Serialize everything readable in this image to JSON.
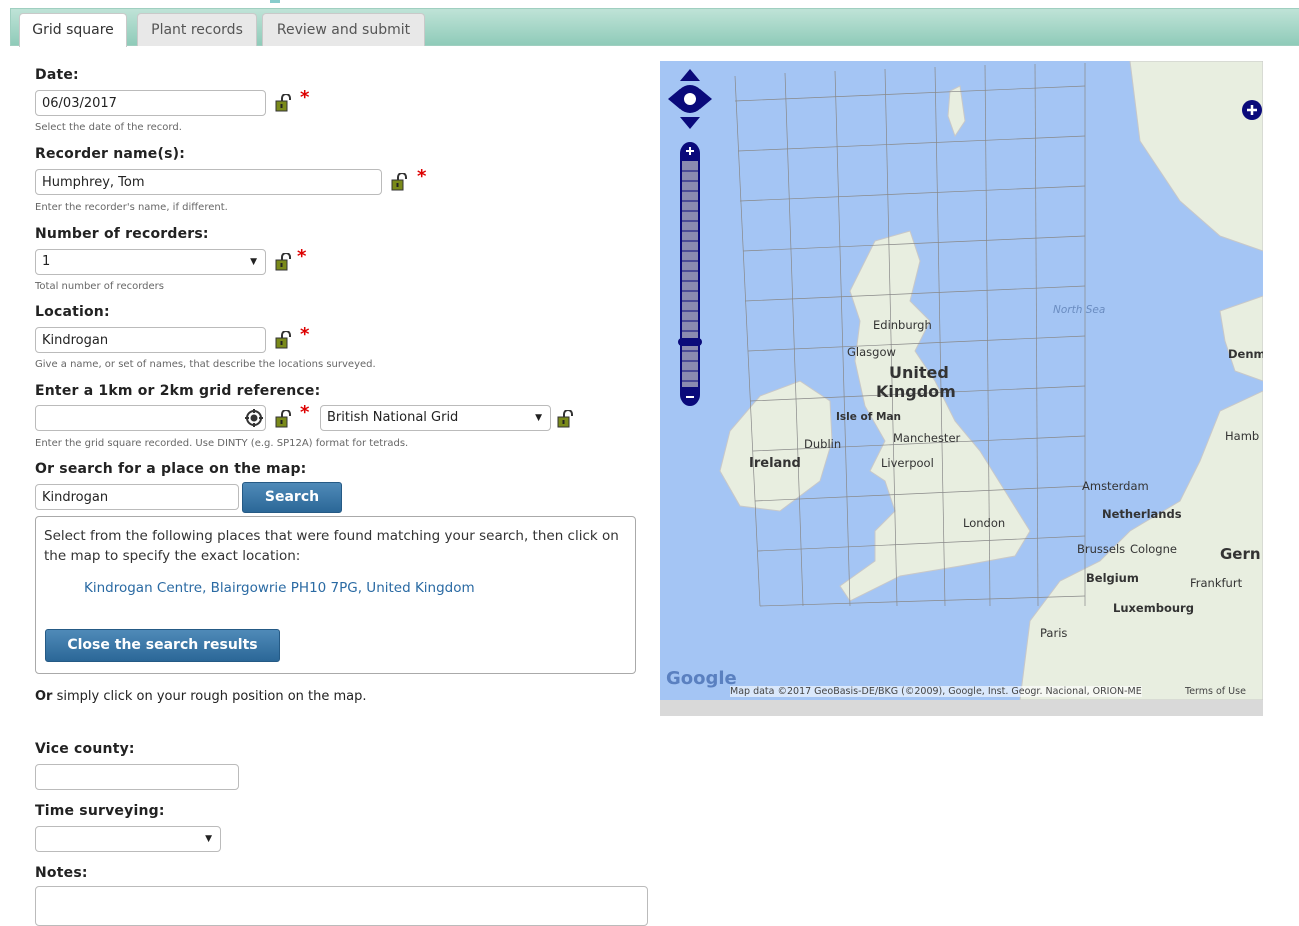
{
  "tabs": [
    {
      "label": "Grid square",
      "active": true
    },
    {
      "label": "Plant records",
      "active": false
    },
    {
      "label": "Review and submit",
      "active": false
    }
  ],
  "form": {
    "date": {
      "label": "Date:",
      "value": "06/03/2017",
      "hint": "Select the date of the record."
    },
    "recorder": {
      "label": "Recorder name(s):",
      "value": "Humphrey, Tom",
      "hint": "Enter the recorder's name, if different."
    },
    "num_recorders": {
      "label": "Number of recorders:",
      "value": "1",
      "hint": "Total number of recorders"
    },
    "location": {
      "label": "Location:",
      "value": "Kindrogan",
      "hint": "Give a name, or set of names, that describe the locations surveyed."
    },
    "gridref": {
      "label": "Enter a 1km or 2km grid reference:",
      "value": "",
      "system": "British National Grid",
      "hint": "Enter the grid square recorded. Use DINTY (e.g. SP12A) format for tetrads."
    },
    "search": {
      "label": "Or search for a place on the map:",
      "value": "Kindrogan",
      "button": "Search"
    },
    "results": {
      "message": "Select from the following places that were found matching your search, then click on the map to specify the exact location:",
      "place": "Kindrogan Centre, Blairgowrie PH10 7PG, United Kingdom",
      "close_button": "Close the search results"
    },
    "click_hint_bold": "Or",
    "click_hint_rest": " simply click on your rough position on the map.",
    "vice_county": {
      "label": "Vice county:",
      "value": ""
    },
    "time_surveying": {
      "label": "Time surveying:",
      "value": ""
    },
    "notes": {
      "label": "Notes:",
      "value": ""
    }
  },
  "map": {
    "labels": {
      "north_sea": "North Sea",
      "edinburgh": "Edinburgh",
      "glasgow": "Glasgow",
      "united": "United",
      "kingdom": "Kingdom",
      "isle_of_man": "Isle of Man",
      "dublin": "Dublin",
      "ireland": "Ireland",
      "manchester": "Manchester",
      "liverpool": "Liverpool",
      "london": "London",
      "amsterdam": "Amsterdam",
      "netherlands": "Netherlands",
      "brussels": "Brussels",
      "cologne": "Cologne",
      "belgium": "Belgium",
      "frankfurt": "Frankfurt",
      "luxembourg": "Luxembourg",
      "paris": "Paris",
      "denmark": "Denm",
      "hamburg": "Hamb",
      "germany": "Gern"
    },
    "attribution": "Map data ©2017 GeoBasis-DE/BKG (©2009), Google, Inst. Geogr. Nacional, ORION-ME",
    "terms": "Terms of Use",
    "google": "Google",
    "colors": {
      "sea": "#a4c5f4",
      "land": "#e8eee0",
      "control": "#0a0a7a"
    }
  }
}
